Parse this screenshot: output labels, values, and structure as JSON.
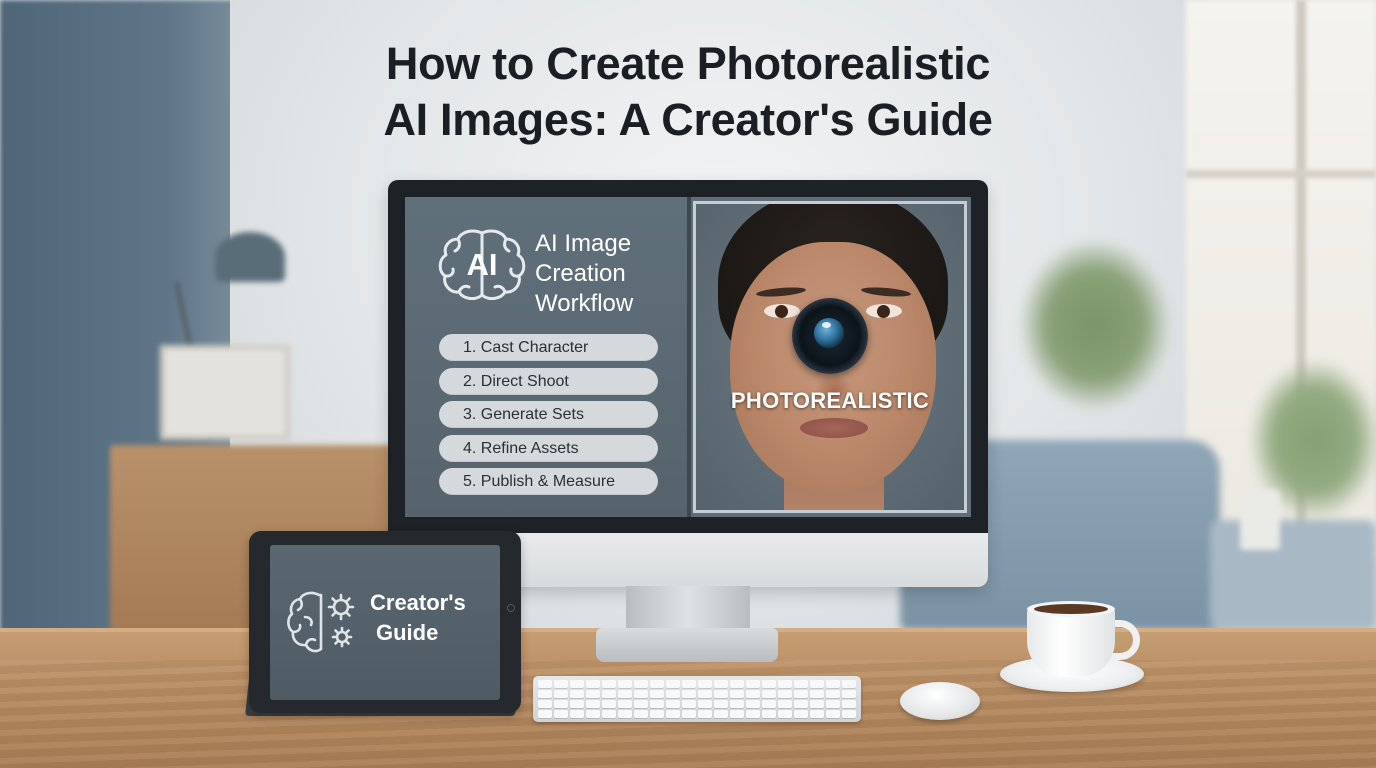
{
  "headline": {
    "line1": "How to Create Photorealistic",
    "line2": "AI Images: A Creator's Guide"
  },
  "monitor": {
    "logo_text": "AI",
    "logo_icon": "brain-icon",
    "workflow_title": {
      "line1": "AI Image",
      "line2": "Creation",
      "line3": "Workflow"
    },
    "steps": [
      {
        "label": "1. Cast Character"
      },
      {
        "label": "2. Direct Shoot"
      },
      {
        "label": "3. Generate Sets"
      },
      {
        "label": "4. Refine Assets"
      },
      {
        "label": "5. Publish & Measure"
      }
    ],
    "portrait_label": "PHOTOREALISTIC",
    "portrait_icon": "camera-lens-icon"
  },
  "tablet": {
    "icon": "brain-gears-icon",
    "title_line1": "Creator's",
    "title_line2": "Guide"
  },
  "colors": {
    "headline": "#1b1e22",
    "screen_panel": "#5f6d78",
    "step_pill": "#d5d9dc",
    "desk": "#b88c62"
  }
}
